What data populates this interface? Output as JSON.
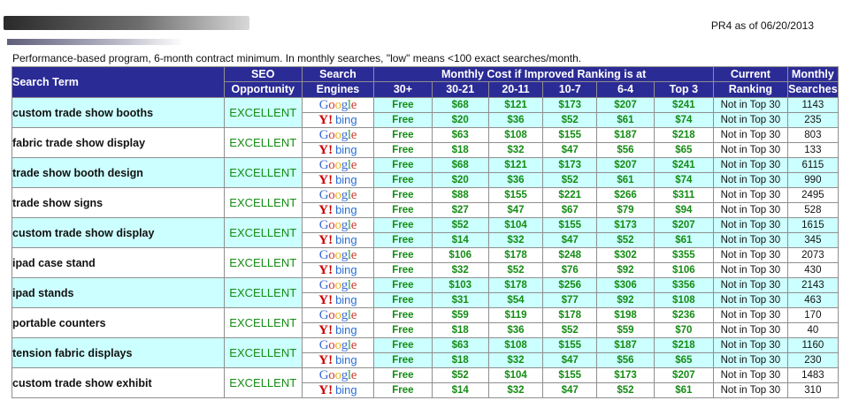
{
  "report": {
    "pr_text": "PR4 as of 06/20/2013",
    "intro": "Performance-based program, 6-month contract minimum. In monthly searches, \"low\" means <100 exact searches/month."
  },
  "headers": {
    "search_term": "Search Term",
    "seo_1": "SEO",
    "seo_2": "Opportunity",
    "engines_1": "Search",
    "engines_2": "Engines",
    "monthly_cost": "Monthly Cost if Improved Ranking is at",
    "current_1": "Current",
    "current_2": "Ranking",
    "monthly_1": "Monthly",
    "monthly_2": "Searches",
    "ranges": [
      "30+",
      "30-21",
      "20-11",
      "10-7",
      "6-4",
      "Top 3"
    ]
  },
  "engine_logos": {
    "google": "Google",
    "yahoo": "Y!",
    "bing": "bing"
  },
  "colors": {
    "header_bg": "#2b2b96",
    "alt_row": "#ccffff",
    "green": "#148c14",
    "google": [
      "#3d6bd8",
      "#d03a2e",
      "#e8b41d",
      "#3d6bd8",
      "#2f9e45",
      "#d03a2e"
    ]
  },
  "rows": [
    {
      "term": "custom trade show booths",
      "seo": "EXCELLENT",
      "google": {
        "c30": "Free",
        "costs": [
          "$68",
          "$121",
          "$173",
          "$207",
          "$241"
        ],
        "rank": "Not in Top 30",
        "vol": "1143"
      },
      "bing": {
        "c30": "Free",
        "costs": [
          "$20",
          "$36",
          "$52",
          "$61",
          "$74"
        ],
        "rank": "Not in Top 30",
        "vol": "235"
      }
    },
    {
      "term": "fabric trade show display",
      "seo": "EXCELLENT",
      "google": {
        "c30": "Free",
        "costs": [
          "$63",
          "$108",
          "$155",
          "$187",
          "$218"
        ],
        "rank": "Not in Top 30",
        "vol": "803"
      },
      "bing": {
        "c30": "Free",
        "costs": [
          "$18",
          "$32",
          "$47",
          "$56",
          "$65"
        ],
        "rank": "Not in Top 30",
        "vol": "133"
      }
    },
    {
      "term": "trade show booth design",
      "seo": "EXCELLENT",
      "google": {
        "c30": "Free",
        "costs": [
          "$68",
          "$121",
          "$173",
          "$207",
          "$241"
        ],
        "rank": "Not in Top 30",
        "vol": "6115"
      },
      "bing": {
        "c30": "Free",
        "costs": [
          "$20",
          "$36",
          "$52",
          "$61",
          "$74"
        ],
        "rank": "Not in Top 30",
        "vol": "990"
      }
    },
    {
      "term": "trade show signs",
      "seo": "EXCELLENT",
      "google": {
        "c30": "Free",
        "costs": [
          "$88",
          "$155",
          "$221",
          "$266",
          "$311"
        ],
        "rank": "Not in Top 30",
        "vol": "2495"
      },
      "bing": {
        "c30": "Free",
        "costs": [
          "$27",
          "$47",
          "$67",
          "$79",
          "$94"
        ],
        "rank": "Not in Top 30",
        "vol": "528"
      }
    },
    {
      "term": "custom trade show display",
      "seo": "EXCELLENT",
      "google": {
        "c30": "Free",
        "costs": [
          "$52",
          "$104",
          "$155",
          "$173",
          "$207"
        ],
        "rank": "Not in Top 30",
        "vol": "1615"
      },
      "bing": {
        "c30": "Free",
        "costs": [
          "$14",
          "$32",
          "$47",
          "$52",
          "$61"
        ],
        "rank": "Not in Top 30",
        "vol": "345"
      }
    },
    {
      "term": "ipad case stand",
      "seo": "EXCELLENT",
      "google": {
        "c30": "Free",
        "costs": [
          "$106",
          "$178",
          "$248",
          "$302",
          "$355"
        ],
        "rank": "Not in Top 30",
        "vol": "2073"
      },
      "bing": {
        "c30": "Free",
        "costs": [
          "$32",
          "$52",
          "$76",
          "$92",
          "$106"
        ],
        "rank": "Not in Top 30",
        "vol": "430"
      }
    },
    {
      "term": "ipad stands",
      "seo": "EXCELLENT",
      "google": {
        "c30": "Free",
        "costs": [
          "$103",
          "$178",
          "$256",
          "$306",
          "$356"
        ],
        "rank": "Not in Top 30",
        "vol": "2143"
      },
      "bing": {
        "c30": "Free",
        "costs": [
          "$31",
          "$54",
          "$77",
          "$92",
          "$108"
        ],
        "rank": "Not in Top 30",
        "vol": "463"
      }
    },
    {
      "term": "portable counters",
      "seo": "EXCELLENT",
      "google": {
        "c30": "Free",
        "costs": [
          "$59",
          "$119",
          "$178",
          "$198",
          "$236"
        ],
        "rank": "Not in Top 30",
        "vol": "170"
      },
      "bing": {
        "c30": "Free",
        "costs": [
          "$18",
          "$36",
          "$52",
          "$59",
          "$70"
        ],
        "rank": "Not in Top 30",
        "vol": "40"
      }
    },
    {
      "term": "tension fabric displays",
      "seo": "EXCELLENT",
      "google": {
        "c30": "Free",
        "costs": [
          "$63",
          "$108",
          "$155",
          "$187",
          "$218"
        ],
        "rank": "Not in Top 30",
        "vol": "1160"
      },
      "bing": {
        "c30": "Free",
        "costs": [
          "$18",
          "$32",
          "$47",
          "$56",
          "$65"
        ],
        "rank": "Not in Top 30",
        "vol": "230"
      }
    },
    {
      "term": "custom trade show exhibit",
      "seo": "EXCELLENT",
      "google": {
        "c30": "Free",
        "costs": [
          "$52",
          "$104",
          "$155",
          "$173",
          "$207"
        ],
        "rank": "Not in Top 30",
        "vol": "1483"
      },
      "bing": {
        "c30": "Free",
        "costs": [
          "$14",
          "$32",
          "$47",
          "$52",
          "$61"
        ],
        "rank": "Not in Top 30",
        "vol": "310"
      }
    }
  ]
}
